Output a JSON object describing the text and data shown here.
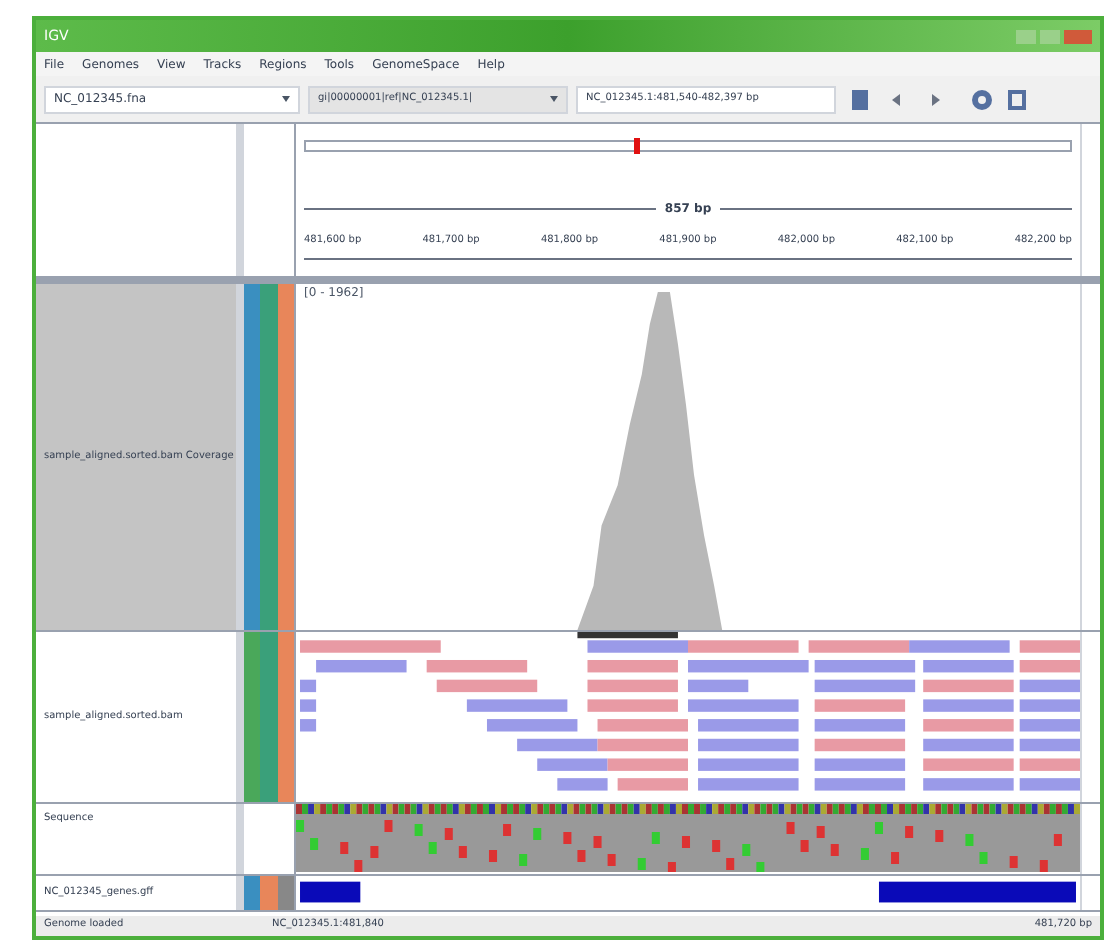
{
  "window": {
    "title": "IGV"
  },
  "menu": [
    "File",
    "Genomes",
    "View",
    "Tracks",
    "Regions",
    "Tools",
    "GenomeSpace",
    "Help"
  ],
  "toolbar": {
    "genome": "NC_012345.fna",
    "chromosome": "gi|00000001|ref|NC_012345.1|",
    "locus": "NC_012345.1:481,540-482,397 bp"
  },
  "ruler": {
    "span": "857 bp",
    "ticks": [
      "481,600 bp",
      "481,700 bp",
      "481,800 bp",
      "481,900 bp",
      "482,000 bp",
      "482,100 bp",
      "482,200 bp"
    ]
  },
  "tracks": [
    {
      "kind": "coverage",
      "name": "sample_aligned.sorted.bam Coverage",
      "scale": "[0 - 1962]"
    },
    {
      "kind": "reads",
      "name": "sample_aligned.sorted.bam"
    },
    {
      "kind": "sequence",
      "name": "Sequence"
    },
    {
      "kind": "features",
      "name": "NC_012345_genes.gff"
    }
  ],
  "status_bar": [
    "Genome loaded",
    "NC_012345.1:481,840",
    "481,720 bp"
  ]
}
